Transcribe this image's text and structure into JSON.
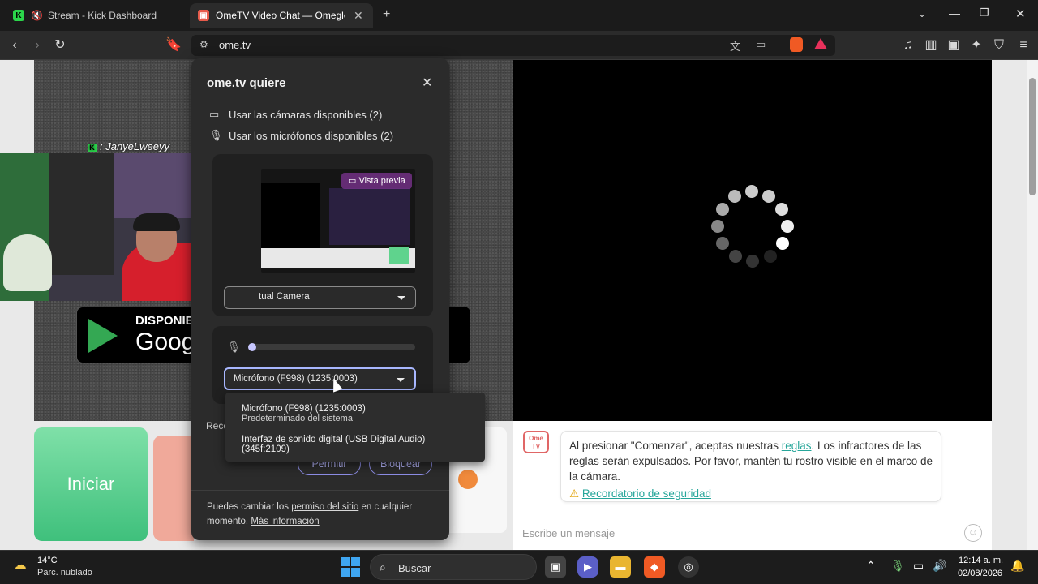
{
  "tabs": [
    {
      "label": "Stream - Kick Dashboard",
      "favicon": "kick-icon"
    },
    {
      "label": "OmeTV Video Chat — Omegle R",
      "favicon": "ometv-icon"
    }
  ],
  "toolbar": {
    "url": "ome.tv"
  },
  "popup": {
    "title": "ome.tv quiere",
    "permissions": [
      {
        "icon": "camera-icon",
        "label": "Usar las cámaras disponibles (2)"
      },
      {
        "icon": "mic-icon",
        "label": "Usar los micrófonos disponibles (2)"
      }
    ],
    "preview_badge": "Vista previa",
    "camera_select": "tual Camera",
    "mic_select": "Micrófono (F998) (1235:0003)",
    "recc_label": "Recc",
    "allow": "Permitir",
    "block": "Bloquear",
    "footer_pre": "Puedes cambiar los ",
    "footer_link": "permiso del sitio",
    "footer_mid": " en cualquier momento. ",
    "footer_more": "Más información"
  },
  "mic_dropdown": {
    "options": [
      {
        "label": "Micrófono (F998) (1235:0003)",
        "sub": "Predeterminado del sistema"
      },
      {
        "label": "Interfaz de sonido digital (USB Digital Audio) (345f:2109)",
        "sub": ""
      }
    ]
  },
  "page": {
    "start_button": "Iniciar",
    "gplay_top": "DISPONIB",
    "gplay_bottom": "Goog",
    "chat_logo": "Ome TV",
    "chat_msg_pre": "Al presionar \"Comenzar\", aceptas nuestras ",
    "chat_msg_link": "reglas",
    "chat_msg_post": ". Los infractores de las reglas serán expulsados. Por favor, mantén tu rostro visible en el marco de la cámara.",
    "safety_link": "Recordatorio de seguridad",
    "chat_placeholder": "Escribe un mensaje"
  },
  "overlay": {
    "streamer": ": JanyeLweeyy"
  },
  "taskbar": {
    "temp": "14°C",
    "condition": "Parc. nublado",
    "search": "Buscar",
    "time": "12:14 a. m.",
    "date": "02/08/2026"
  }
}
